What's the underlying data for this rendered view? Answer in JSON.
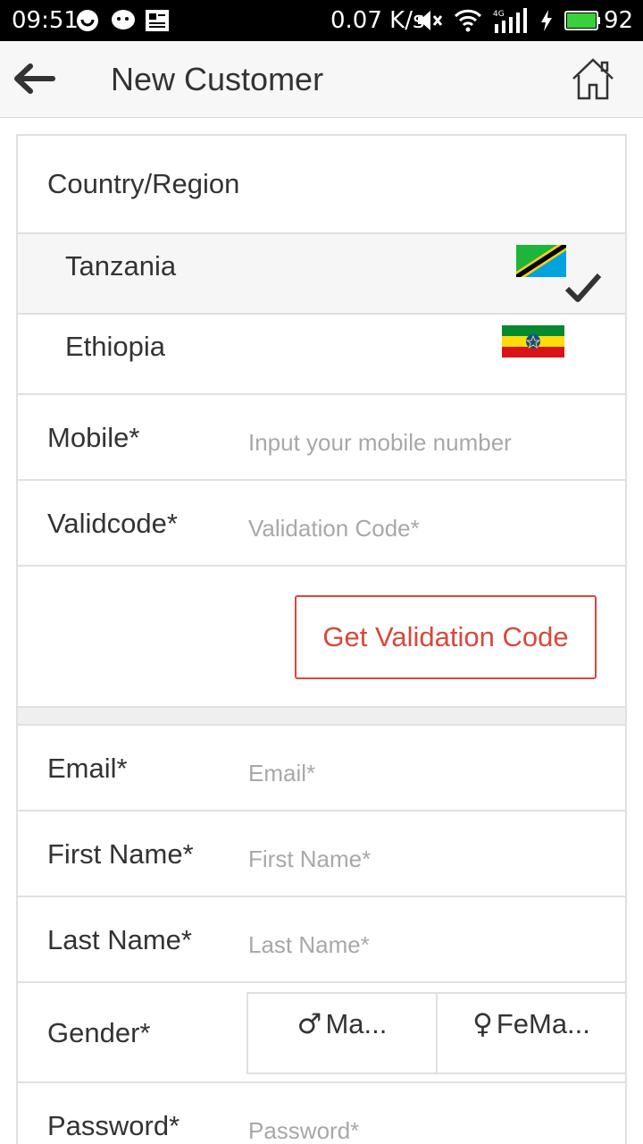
{
  "status_bar": {
    "time": "09:51",
    "network_speed": "0.07 K/s",
    "signal_label": "4G",
    "battery": "92",
    "battery_color": "#39d13b"
  },
  "app_bar": {
    "title": "New Customer",
    "back_icon": "arrow-left-icon",
    "home_icon": "home-icon"
  },
  "country_section": {
    "label": "Country/Region",
    "countries": [
      {
        "name": "Tanzania",
        "flag": "tanzania-flag",
        "selected": true
      },
      {
        "name": "Ethiopia",
        "flag": "ethiopia-flag",
        "selected": false
      }
    ]
  },
  "mobile": {
    "label": "Mobile*",
    "placeholder": "Input your mobile number"
  },
  "validcode": {
    "label": "Validcode*",
    "placeholder": "Validation Code*"
  },
  "get_code_button": "Get Validation Code",
  "email": {
    "label": "Email*",
    "placeholder": "Email*"
  },
  "first_name": {
    "label": "First Name*",
    "placeholder": "First Name*"
  },
  "last_name": {
    "label": "Last Name*",
    "placeholder": "Last Name*"
  },
  "gender": {
    "label": "Gender*",
    "options": [
      {
        "symbol": "♂",
        "label": "Ma..."
      },
      {
        "symbol": "♀",
        "label": "FeMa..."
      }
    ]
  },
  "password": {
    "label": "Password*",
    "placeholder": "Password*"
  },
  "colors": {
    "accent": "#d8483a",
    "placeholder": "#a8a8a8"
  }
}
